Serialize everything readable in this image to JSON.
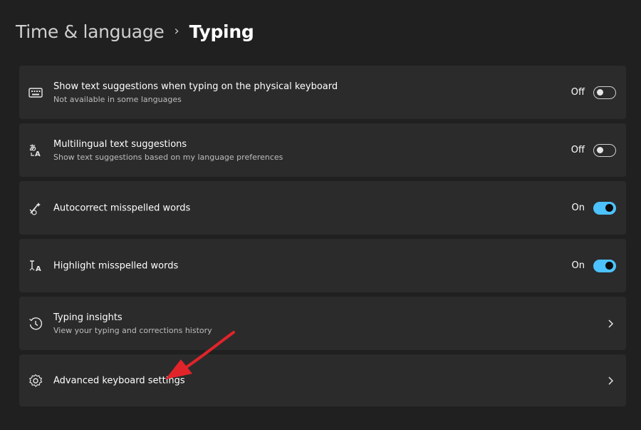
{
  "breadcrumb": {
    "parent": "Time & language",
    "separator": "›",
    "current": "Typing"
  },
  "settings": [
    {
      "title": "Show text suggestions when typing on the physical keyboard",
      "subtitle": "Not available in some languages",
      "icon": "keyboard-icon",
      "control": "toggle",
      "state_label": "Off",
      "state": false
    },
    {
      "title": "Multilingual text suggestions",
      "subtitle": "Show text suggestions based on my language preferences",
      "icon": "language-icon",
      "control": "toggle",
      "state_label": "Off",
      "state": false
    },
    {
      "title": "Autocorrect misspelled words",
      "subtitle": "",
      "icon": "autocorrect-icon",
      "control": "toggle",
      "state_label": "On",
      "state": true
    },
    {
      "title": "Highlight misspelled words",
      "subtitle": "",
      "icon": "highlight-spelling-icon",
      "control": "toggle",
      "state_label": "On",
      "state": true
    },
    {
      "title": "Typing insights",
      "subtitle": "View your typing and corrections history",
      "icon": "history-icon",
      "control": "chevron"
    },
    {
      "title": "Advanced keyboard settings",
      "subtitle": "",
      "icon": "gear-icon",
      "control": "chevron"
    }
  ],
  "colors": {
    "background": "#202020",
    "card": "#2b2b2b",
    "accent": "#4cc2ff",
    "annotation_arrow": "#e0242a"
  }
}
